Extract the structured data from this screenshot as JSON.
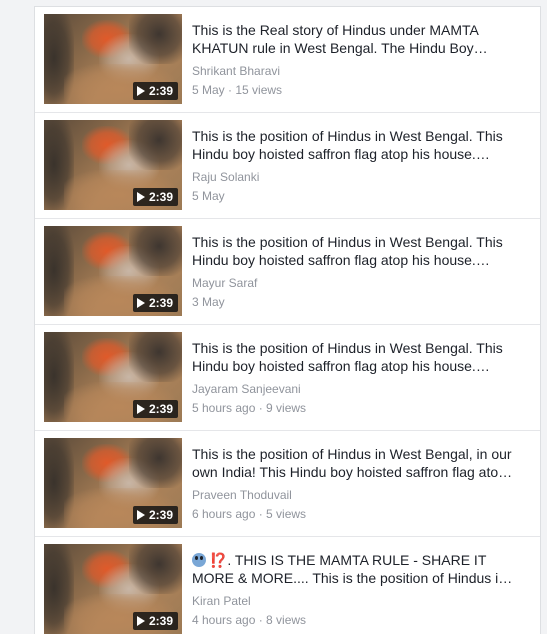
{
  "videos": [
    {
      "title": "This is the Real story of Hindus under MAMTA KHATUN rule in West Bengal. The Hindu Boy…",
      "author": "Shrikant Bharavi",
      "meta": "5 May · 15 views",
      "duration": "2:39"
    },
    {
      "title": "This is the position of Hindus in West Bengal. This Hindu boy hoisted saffron flag atop his house.…",
      "author": "Raju Solanki",
      "meta": "5 May",
      "duration": "2:39"
    },
    {
      "title": "This is the position of Hindus in West Bengal. This Hindu boy hoisted saffron flag atop his house.…",
      "author": "Mayur Saraf",
      "meta": "3 May",
      "duration": "2:39"
    },
    {
      "title": "This is the position of Hindus in West Bengal. This Hindu boy hoisted saffron flag atop his house.…",
      "author": "Jayaram Sanjeevani",
      "meta": "5 hours ago · 9 views",
      "duration": "2:39"
    },
    {
      "title": "This is the position of Hindus in West Bengal, in our own India! This Hindu boy hoisted saffron flag ato…",
      "author": "Praveen Thoduvail",
      "meta": "6 hours ago · 5 views",
      "duration": "2:39"
    },
    {
      "title": ". THIS IS THE MAMTA RULE - SHARE IT MORE & MORE.... This is the position of Hindus i…",
      "title_prefix_emoji": "⁉️",
      "author": "Kiran Patel",
      "meta": "4 hours ago · 8 views",
      "duration": "2:39"
    }
  ]
}
